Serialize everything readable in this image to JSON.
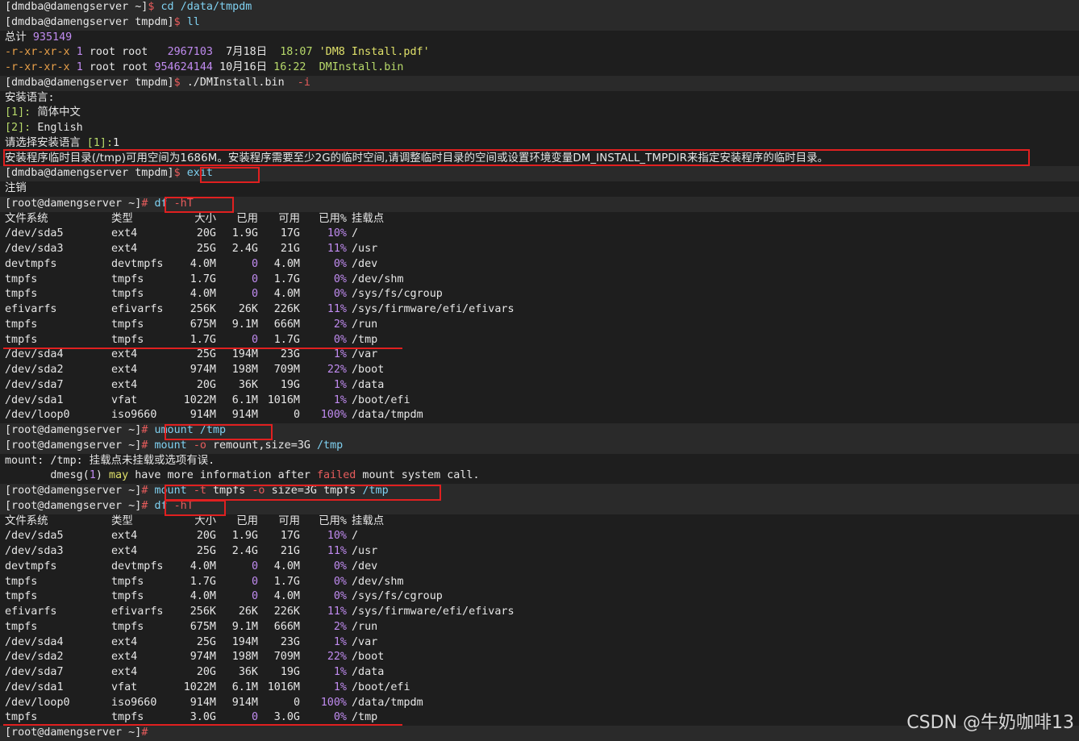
{
  "colors": {
    "background": "#1e1e1e",
    "highlight": "#e02020",
    "command": "#7fd0f0",
    "number": "#c08bf0",
    "prompt_symbol": "#e85c5c"
  },
  "prompts": {
    "dmdba_home": "[dmdba@damengserver ~]",
    "dmdba_tmpdm": "[dmdba@damengserver tmpdm]",
    "root_home": "[root@damengserver ~]",
    "dollar": "$",
    "hash": "#"
  },
  "cmd_cd": {
    "cmd": "cd",
    "arg": "/data/tmpdm"
  },
  "cmd_ll": "ll",
  "ll_total": {
    "label": "总计",
    "value": "935149"
  },
  "ll_rows": [
    {
      "perm": "-r-xr-xr-x",
      "links": "1",
      "owner": "root",
      "group": "root",
      "size": "2967103",
      "month": "7月",
      "day": "18日",
      "time": "18:07",
      "name": "'DM8 Install.pdf'"
    },
    {
      "perm": "-r-xr-xr-x",
      "links": "1",
      "owner": "root",
      "group": "root",
      "size": "954624144",
      "month": "10月",
      "day": "16日",
      "time": "16:22",
      "name": "DMInstall.bin"
    }
  ],
  "cmd_install": {
    "cmd": "./DMInstall.bin",
    "opt": "-i"
  },
  "install": {
    "lang_prompt": "安装语言:",
    "opt1_key": "[1]:",
    "opt1_val": "简体中文",
    "opt2_key": "[2]:",
    "opt2_val": "English",
    "choose_label": "请选择安装语言",
    "choose_default": "[1]:",
    "choose_value": "1",
    "error_msg": "安装程序临时目录(/tmp)可用空间为1686M。安装程序需要至少2G的临时空间,请调整临时目录的空间或设置环境变量DM_INSTALL_TMPDIR来指定安装程序的临时目录。"
  },
  "cmd_exit": "exit",
  "logout": "注销",
  "cmd_df": {
    "cmd": "df",
    "opt": "-hT"
  },
  "df_header": {
    "fs": "文件系统",
    "type": "类型",
    "size": "大小",
    "used": "已用",
    "avail": "可用",
    "pct": "已用%",
    "mount": "挂载点"
  },
  "df1_rows": [
    {
      "fs": "/dev/sda5",
      "type": "ext4",
      "size": "20G",
      "used": "1.9G",
      "avail": "17G",
      "pct": "10%",
      "mount": "/"
    },
    {
      "fs": "/dev/sda3",
      "type": "ext4",
      "size": "25G",
      "used": "2.4G",
      "avail": "21G",
      "pct": "11%",
      "mount": "/usr"
    },
    {
      "fs": "devtmpfs",
      "type": "devtmpfs",
      "size": "4.0M",
      "used": "0",
      "avail": "4.0M",
      "pct": "0%",
      "mount": "/dev"
    },
    {
      "fs": "tmpfs",
      "type": "tmpfs",
      "size": "1.7G",
      "used": "0",
      "avail": "1.7G",
      "pct": "0%",
      "mount": "/dev/shm"
    },
    {
      "fs": "tmpfs",
      "type": "tmpfs",
      "size": "4.0M",
      "used": "0",
      "avail": "4.0M",
      "pct": "0%",
      "mount": "/sys/fs/cgroup"
    },
    {
      "fs": "efivarfs",
      "type": "efivarfs",
      "size": "256K",
      "used": "26K",
      "avail": "226K",
      "pct": "11%",
      "mount": "/sys/firmware/efi/efivars"
    },
    {
      "fs": "tmpfs",
      "type": "tmpfs",
      "size": "675M",
      "used": "9.1M",
      "avail": "666M",
      "pct": "2%",
      "mount": "/run"
    },
    {
      "fs": "tmpfs",
      "type": "tmpfs",
      "size": "1.7G",
      "used": "0",
      "avail": "1.7G",
      "pct": "0%",
      "mount": "/tmp"
    },
    {
      "fs": "/dev/sda4",
      "type": "ext4",
      "size": "25G",
      "used": "194M",
      "avail": "23G",
      "pct": "1%",
      "mount": "/var"
    },
    {
      "fs": "/dev/sda2",
      "type": "ext4",
      "size": "974M",
      "used": "198M",
      "avail": "709M",
      "pct": "22%",
      "mount": "/boot"
    },
    {
      "fs": "/dev/sda7",
      "type": "ext4",
      "size": "20G",
      "used": "36K",
      "avail": "19G",
      "pct": "1%",
      "mount": "/data"
    },
    {
      "fs": "/dev/sda1",
      "type": "vfat",
      "size": "1022M",
      "used": "6.1M",
      "avail": "1016M",
      "pct": "1%",
      "mount": "/boot/efi"
    },
    {
      "fs": "/dev/loop0",
      "type": "iso9660",
      "size": "914M",
      "used": "914M",
      "avail": "0",
      "pct": "100%",
      "mount": "/data/tmpdm"
    }
  ],
  "cmd_umount": {
    "cmd": "umount",
    "arg": "/tmp"
  },
  "cmd_remount": {
    "cmd": "mount",
    "opt": "-o",
    "arg1": "remount,size=",
    "arg2": "3G",
    "arg3": "/tmp"
  },
  "mount_err": {
    "line1": "mount: /tmp: 挂载点未挂载或选项有误.",
    "pre": "       dmesg(",
    "num": "1",
    "mid": ") ",
    "may": "may",
    "text": " have more information after ",
    "failed": "failed",
    "end": " mount system call."
  },
  "cmd_mount_tmpfs": {
    "cmd": "mount",
    "opt1": "-t",
    "arg1": "tmpfs",
    "opt2": "-o",
    "arg2": "size=",
    "arg3": "3G",
    "arg4": "tmpfs",
    "arg5": "/tmp"
  },
  "df2_rows": [
    {
      "fs": "/dev/sda5",
      "type": "ext4",
      "size": "20G",
      "used": "1.9G",
      "avail": "17G",
      "pct": "10%",
      "mount": "/"
    },
    {
      "fs": "/dev/sda3",
      "type": "ext4",
      "size": "25G",
      "used": "2.4G",
      "avail": "21G",
      "pct": "11%",
      "mount": "/usr"
    },
    {
      "fs": "devtmpfs",
      "type": "devtmpfs",
      "size": "4.0M",
      "used": "0",
      "avail": "4.0M",
      "pct": "0%",
      "mount": "/dev"
    },
    {
      "fs": "tmpfs",
      "type": "tmpfs",
      "size": "1.7G",
      "used": "0",
      "avail": "1.7G",
      "pct": "0%",
      "mount": "/dev/shm"
    },
    {
      "fs": "tmpfs",
      "type": "tmpfs",
      "size": "4.0M",
      "used": "0",
      "avail": "4.0M",
      "pct": "0%",
      "mount": "/sys/fs/cgroup"
    },
    {
      "fs": "efivarfs",
      "type": "efivarfs",
      "size": "256K",
      "used": "26K",
      "avail": "226K",
      "pct": "11%",
      "mount": "/sys/firmware/efi/efivars"
    },
    {
      "fs": "tmpfs",
      "type": "tmpfs",
      "size": "675M",
      "used": "9.1M",
      "avail": "666M",
      "pct": "2%",
      "mount": "/run"
    },
    {
      "fs": "/dev/sda4",
      "type": "ext4",
      "size": "25G",
      "used": "194M",
      "avail": "23G",
      "pct": "1%",
      "mount": "/var"
    },
    {
      "fs": "/dev/sda2",
      "type": "ext4",
      "size": "974M",
      "used": "198M",
      "avail": "709M",
      "pct": "22%",
      "mount": "/boot"
    },
    {
      "fs": "/dev/sda7",
      "type": "ext4",
      "size": "20G",
      "used": "36K",
      "avail": "19G",
      "pct": "1%",
      "mount": "/data"
    },
    {
      "fs": "/dev/sda1",
      "type": "vfat",
      "size": "1022M",
      "used": "6.1M",
      "avail": "1016M",
      "pct": "1%",
      "mount": "/boot/efi"
    },
    {
      "fs": "/dev/loop0",
      "type": "iso9660",
      "size": "914M",
      "used": "914M",
      "avail": "0",
      "pct": "100%",
      "mount": "/data/tmpdm"
    },
    {
      "fs": "tmpfs",
      "type": "tmpfs",
      "size": "3.0G",
      "used": "0",
      "avail": "3.0G",
      "pct": "0%",
      "mount": "/tmp"
    }
  ],
  "watermark": "CSDN @牛奶咖啡13"
}
